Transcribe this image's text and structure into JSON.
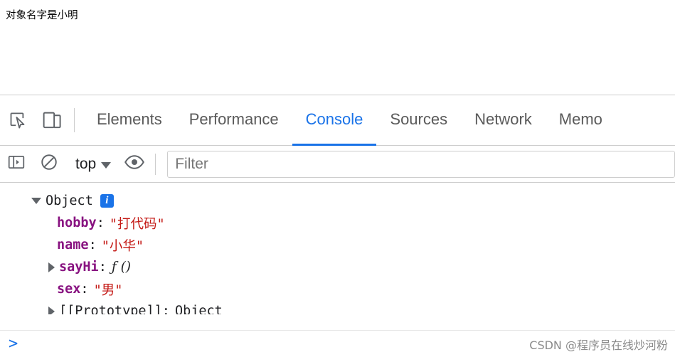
{
  "page": {
    "content_text": "对象名字是小明"
  },
  "devtools": {
    "toolbar": {
      "inspect_icon": "cursor-inspect-icon",
      "device_toolbar_icon": "device-toggle-icon",
      "tabs": [
        {
          "label": "Elements",
          "active": false
        },
        {
          "label": "Performance",
          "active": false
        },
        {
          "label": "Console",
          "active": true
        },
        {
          "label": "Sources",
          "active": false
        },
        {
          "label": "Network",
          "active": false
        },
        {
          "label": "Memo",
          "active": false
        }
      ]
    },
    "filterbar": {
      "sidebar_toggle_icon": "show-console-sidebar-icon",
      "clear_icon": "clear-console-icon",
      "context": "top",
      "eye_icon": "live-expression-icon",
      "filter_placeholder": "Filter"
    },
    "console": {
      "root": {
        "label": "Object",
        "badge": "i",
        "expanded": true
      },
      "properties": [
        {
          "key": "hobby",
          "value": "\"打代码\"",
          "type": "string",
          "expandable": false
        },
        {
          "key": "name",
          "value": "\"小华\"",
          "type": "string",
          "expandable": false
        },
        {
          "key": "sayHi",
          "value": "ƒ ()",
          "type": "function",
          "expandable": true
        },
        {
          "key": "sex",
          "value": "\"男\"",
          "type": "string",
          "expandable": false
        },
        {
          "key": "[[Prototype]]",
          "value": "Object",
          "type": "proto",
          "expandable": true
        }
      ],
      "prompt_symbol": ">"
    }
  },
  "watermark": {
    "text": "CSDN @程序员在线炒河粉"
  },
  "colors": {
    "accent": "#1a73e8",
    "string_value": "#c41a16",
    "property_key": "#881280",
    "border": "#cdcdcd"
  }
}
